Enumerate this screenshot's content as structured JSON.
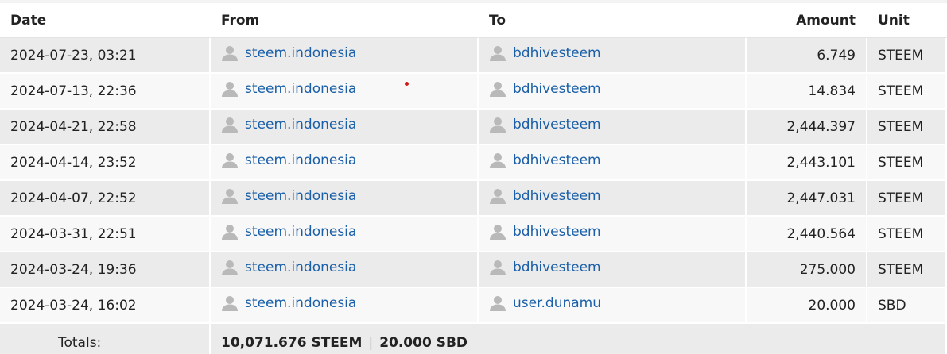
{
  "table": {
    "headers": {
      "date": "Date",
      "from": "From",
      "to": "To",
      "amount": "Amount",
      "unit": "Unit"
    },
    "rows": [
      {
        "date": "2024-07-23, 03:21",
        "from": "steem.indonesia",
        "to": "bdhivesteem",
        "amount": "6.749",
        "unit": "STEEM"
      },
      {
        "date": "2024-07-13, 22:36",
        "from": "steem.indonesia",
        "to": "bdhivesteem",
        "amount": "14.834",
        "unit": "STEEM"
      },
      {
        "date": "2024-04-21, 22:58",
        "from": "steem.indonesia",
        "to": "bdhivesteem",
        "amount": "2,444.397",
        "unit": "STEEM"
      },
      {
        "date": "2024-04-14, 23:52",
        "from": "steem.indonesia",
        "to": "bdhivesteem",
        "amount": "2,443.101",
        "unit": "STEEM"
      },
      {
        "date": "2024-04-07, 22:52",
        "from": "steem.indonesia",
        "to": "bdhivesteem",
        "amount": "2,447.031",
        "unit": "STEEM"
      },
      {
        "date": "2024-03-31, 22:51",
        "from": "steem.indonesia",
        "to": "bdhivesteem",
        "amount": "2,440.564",
        "unit": "STEEM"
      },
      {
        "date": "2024-03-24, 19:36",
        "from": "steem.indonesia",
        "to": "bdhivesteem",
        "amount": "275.000",
        "unit": "STEEM"
      },
      {
        "date": "2024-03-24, 16:02",
        "from": "steem.indonesia",
        "to": "user.dunamu",
        "amount": "20.000",
        "unit": "SBD"
      }
    ],
    "totals": {
      "label": "Totals:",
      "steem": "10,071.676 STEEM",
      "separator": "|",
      "sbd": "20.000 SBD"
    }
  },
  "icons": {
    "account": "user-icon"
  },
  "colors": {
    "link": "#1a5fa8",
    "row_odd": "#ebebeb",
    "row_even": "#f8f8f8",
    "marker": "#d11a1a"
  }
}
